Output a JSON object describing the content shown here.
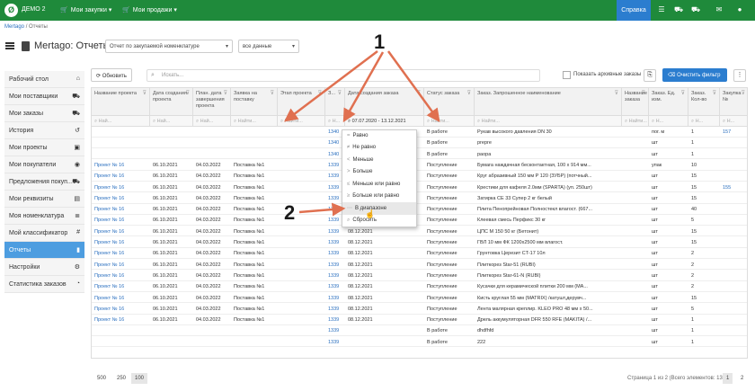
{
  "topbar": {
    "logo": "Ø",
    "brand": "ДЕМО 2",
    "menu": [
      "Мои закупки",
      "Мои продажи"
    ],
    "help": "Справка",
    "icons": [
      "list-icon",
      "cart-icon",
      "cart-icon",
      "comments-icon",
      "user-icon"
    ]
  },
  "breadcrumb": {
    "root": "Mertago",
    "sep": "/",
    "current": "Отчеты"
  },
  "page": {
    "title": "Mertago: Отчеты",
    "report_select": "Отчет по закупаемой номенклатуре",
    "data_select": "все данные"
  },
  "sidebar": {
    "items": [
      {
        "label": "Рабочий стол",
        "icon": "home-icon"
      },
      {
        "label": "Мои поставщики",
        "icon": "truck-icon"
      },
      {
        "label": "Мои заказы",
        "icon": "cart-icon"
      },
      {
        "label": "История",
        "icon": "history-icon"
      },
      {
        "label": "Мои проекты",
        "icon": "briefcase-icon"
      },
      {
        "label": "Мои покупатели",
        "icon": "eye-icon"
      },
      {
        "label": "Предложения покуп...",
        "icon": "truck-icon"
      },
      {
        "label": "Мои реквизиты",
        "icon": "card-icon"
      },
      {
        "label": "Моя номенклатура",
        "icon": "list-icon"
      },
      {
        "label": "Мой классификатор",
        "icon": "hash-icon"
      },
      {
        "label": "Отчеты",
        "icon": "file-icon",
        "active": true
      },
      {
        "label": "Настройки",
        "icon": "gears-icon"
      },
      {
        "label": "Статистика заказов",
        "icon": "pie-icon"
      }
    ]
  },
  "toolbar": {
    "refresh": "Обновить",
    "search_placeholder": "Искать...",
    "archive_label": "Показать архивные заказы",
    "clear_filter": "Очистить фильтр"
  },
  "grid": {
    "columns": [
      {
        "label": "Название проекта",
        "filter": "Най..."
      },
      {
        "label": "Дата создания проекта",
        "filter": "Най..."
      },
      {
        "label": "План. дата завершения проекта",
        "filter": "Най..."
      },
      {
        "label": "Заявка на поставку",
        "filter": "Найти..."
      },
      {
        "label": "Этап проекта",
        "filter": "Найти..."
      },
      {
        "label": "З...",
        "filter": "Н..."
      },
      {
        "label": "Дата создания заказа",
        "filter": "07.07.2020 - 13.12.2021"
      },
      {
        "label": "Статус заказа",
        "filter": "Найти..."
      },
      {
        "label": "Заказ. Запрошенное наименование",
        "filter": "Найти..."
      },
      {
        "label": "Название заказа",
        "filter": "Найти..."
      },
      {
        "label": "Заказ. Ед. изм.",
        "filter": "Н..."
      },
      {
        "label": "Заказ. Кол-во",
        "filter": "Н..."
      },
      {
        "label": "Закупка №",
        "filter": "Н..."
      }
    ],
    "rows": [
      [
        "",
        "",
        "",
        "",
        "",
        "1340",
        "",
        "В работе",
        "Рукав высокого давления DN 30",
        "",
        "пог. м",
        "1",
        "157"
      ],
      [
        "",
        "",
        "",
        "",
        "",
        "1340",
        "",
        "В работе",
        "prepre",
        "",
        "шт",
        "1",
        ""
      ],
      [
        "",
        "",
        "",
        "",
        "",
        "1340",
        "",
        "В работе",
        "paopa",
        "",
        "шт",
        "1",
        ""
      ],
      [
        "Проект № 16",
        "06.10.2021",
        "04.03.2022",
        "Поставка №1",
        "",
        "1339",
        "",
        "Поступление",
        "Бумага наждачная бесконтактная, 100 x 914 мм...",
        "",
        "упак",
        "10",
        ""
      ],
      [
        "Проект № 16",
        "06.10.2021",
        "04.03.2022",
        "Поставка №1",
        "",
        "1339",
        "",
        "Поступление",
        "Круг абразивный 150 мм P 120 (ЗУБР) (потчный...",
        "",
        "шт",
        "15",
        ""
      ],
      [
        "Проект № 16",
        "06.10.2021",
        "04.03.2022",
        "Поставка №1",
        "",
        "1339",
        "",
        "Поступление",
        "Крестики для кафеля 2.0мм (SPARTA) (уп. 250шт)",
        "",
        "шт",
        "15",
        "155"
      ],
      [
        "Проект № 16",
        "06.10.2021",
        "04.03.2022",
        "Поставка №1",
        "",
        "1339",
        "",
        "Поступление",
        "Затирка CE 33 Супер 2 кг белый",
        "",
        "шт",
        "15",
        ""
      ],
      [
        "Проект № 16",
        "06.10.2021",
        "04.03.2022",
        "Поставка №1",
        "",
        "1339",
        "",
        "Поступление",
        "Плита Пенопрейновая Полностекл влагост. (667...",
        "",
        "шт",
        "40",
        ""
      ],
      [
        "Проект № 16",
        "06.10.2021",
        "04.03.2022",
        "Поставка №1",
        "",
        "1339",
        "",
        "Поступление",
        "Клеевая смесь Перфикс 30 кг",
        "",
        "шт",
        "5",
        ""
      ],
      [
        "Проект № 16",
        "06.10.2021",
        "04.03.2022",
        "Поставка №1",
        "",
        "1339",
        "08.12.2021",
        "Поступление",
        "ЦПС М 150 50 кг (Бетонит)",
        "",
        "шт",
        "15",
        ""
      ],
      [
        "Проект № 16",
        "06.10.2021",
        "04.03.2022",
        "Поставка №1",
        "",
        "1339",
        "08.12.2021",
        "Поступление",
        "ГВЛ 10 мм ФК 1200x2500 мм влагост.",
        "",
        "шт",
        "15",
        ""
      ],
      [
        "Проект № 16",
        "06.10.2021",
        "04.03.2022",
        "Поставка №1",
        "",
        "1339",
        "08.12.2021",
        "Поступление",
        "Грунтовка Церезит CT-17 10л",
        "",
        "шт",
        "2",
        ""
      ],
      [
        "Проект № 16",
        "06.10.2021",
        "04.03.2022",
        "Поставка №1",
        "",
        "1339",
        "08.12.2021",
        "Поступление",
        "Плиткорез Star-51 (RUBI)",
        "",
        "шт",
        "2",
        ""
      ],
      [
        "Проект № 16",
        "06.10.2021",
        "04.03.2022",
        "Поставка №1",
        "",
        "1339",
        "08.12.2021",
        "Поступление",
        "Плиткорез Star-61-N (RUBI)",
        "",
        "шт",
        "2",
        ""
      ],
      [
        "Проект № 16",
        "06.10.2021",
        "04.03.2022",
        "Поставка №1",
        "",
        "1339",
        "08.12.2021",
        "Поступление",
        "Кусачки для керамической плитки 200 мм (МА...",
        "",
        "шт",
        "2",
        ""
      ],
      [
        "Проект № 16",
        "06.10.2021",
        "04.03.2022",
        "Поставка №1",
        "",
        "1339",
        "08.12.2021",
        "Поступление",
        "Кисть круглая 55 мм (MATRIX) /катушт,дерувч...",
        "",
        "шт",
        "15",
        ""
      ],
      [
        "Проект № 16",
        "06.10.2021",
        "04.03.2022",
        "Поставка №1",
        "",
        "1339",
        "08.12.2021",
        "Поступление",
        "Лента малярная креплир. KLEO PRO 48 мм x 50...",
        "",
        "шт",
        "5",
        ""
      ],
      [
        "Проект № 16",
        "06.10.2021",
        "04.03.2022",
        "Поставка №1",
        "",
        "1339",
        "08.12.2021",
        "Поступление",
        "Дрель аккумуляторная DFR 550 RFE (MAKITA) /...",
        "",
        "шт",
        "1",
        ""
      ],
      [
        "",
        "",
        "",
        "",
        "",
        "1339",
        "",
        "В работе",
        "dhdfhfd",
        "",
        "шт",
        "1",
        ""
      ],
      [
        "",
        "",
        "",
        "",
        "",
        "1339",
        "",
        "В работе",
        "222",
        "",
        "шт",
        "1",
        ""
      ]
    ]
  },
  "dropdown": {
    "items": [
      {
        "glyph": "=",
        "label": "Равно"
      },
      {
        "glyph": "≠",
        "label": "Не равно"
      },
      {
        "glyph": "<",
        "label": "Меньше"
      },
      {
        "glyph": ">",
        "label": "Больше"
      },
      {
        "glyph": "≤",
        "label": "Меньше или равно"
      },
      {
        "glyph": "≥",
        "label": "Больше или равно"
      },
      {
        "glyph": "⋯",
        "label": "В диапазоне",
        "highlight": true
      },
      {
        "glyph": "⌕",
        "label": "Сбросить"
      }
    ]
  },
  "annotations": {
    "one": "1",
    "two": "2"
  },
  "pager": {
    "sizes": [
      "500",
      "250",
      "100"
    ],
    "current_size": "100",
    "info": "Страница 1 из 2 (Всего элементов: 133)",
    "pages": [
      "1",
      "2"
    ],
    "current_page": "1"
  },
  "colors": {
    "green": "#1f8a3b",
    "blue": "#2b7dcf",
    "active": "#4d9de0",
    "link": "#2a6fbf"
  }
}
